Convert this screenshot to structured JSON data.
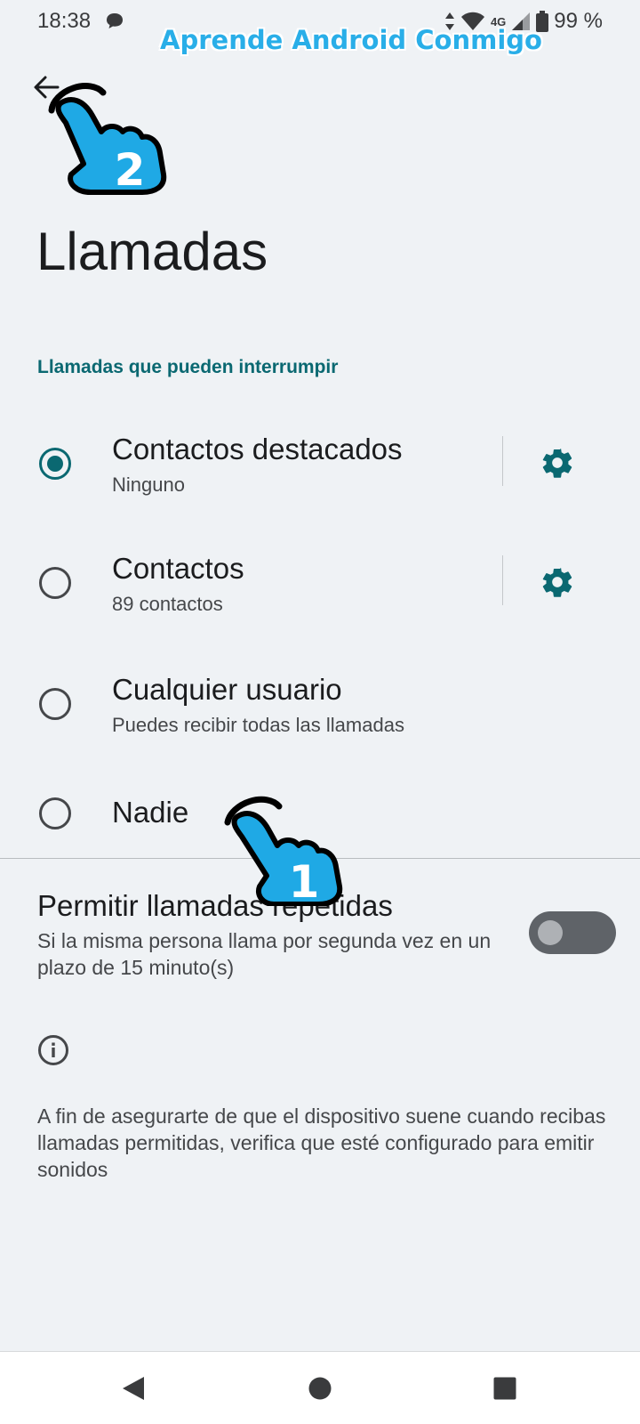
{
  "status_bar": {
    "time": "18:38",
    "network": "4G",
    "battery": "99 %",
    "icons": [
      "chat-bubble-icon",
      "data-arrows-icon",
      "wifi-icon",
      "signal-icon",
      "battery-icon"
    ]
  },
  "watermark": "Aprende Android Conmigo",
  "header": {
    "back_icon": "arrow-back-icon",
    "title": "Llamadas"
  },
  "section": {
    "title": "Llamadas que pueden interrumpir",
    "options": [
      {
        "label": "Contactos destacados",
        "sublabel": "Ninguno",
        "selected": true,
        "has_settings": true
      },
      {
        "label": "Contactos",
        "sublabel": "89 contactos",
        "selected": false,
        "has_settings": true
      },
      {
        "label": "Cualquier usuario",
        "sublabel": "Puedes recibir todas las llamadas",
        "selected": false,
        "has_settings": false
      },
      {
        "label": "Nadie",
        "sublabel": "",
        "selected": false,
        "has_settings": false
      }
    ]
  },
  "repeat_calls": {
    "title": "Permitir llamadas repetidas",
    "subtitle": "Si la misma persona llama por segunda vez en un plazo de 15 minuto(s)",
    "enabled": false
  },
  "info": {
    "icon": "info-icon",
    "text": "A fin de asegurarte de que el dispositivo suene cuando recibas llamadas permitidas, verifica que esté configurado para emitir sonidos"
  },
  "annotations": [
    {
      "number": "1",
      "target": "Nadie"
    },
    {
      "number": "2",
      "target": "back"
    }
  ],
  "nav": {
    "icons": [
      "nav-back-icon",
      "nav-home-icon",
      "nav-recents-icon"
    ]
  },
  "colors": {
    "accent": "#0a6871",
    "background": "#eff2f5",
    "watermark": "#29aee8"
  }
}
